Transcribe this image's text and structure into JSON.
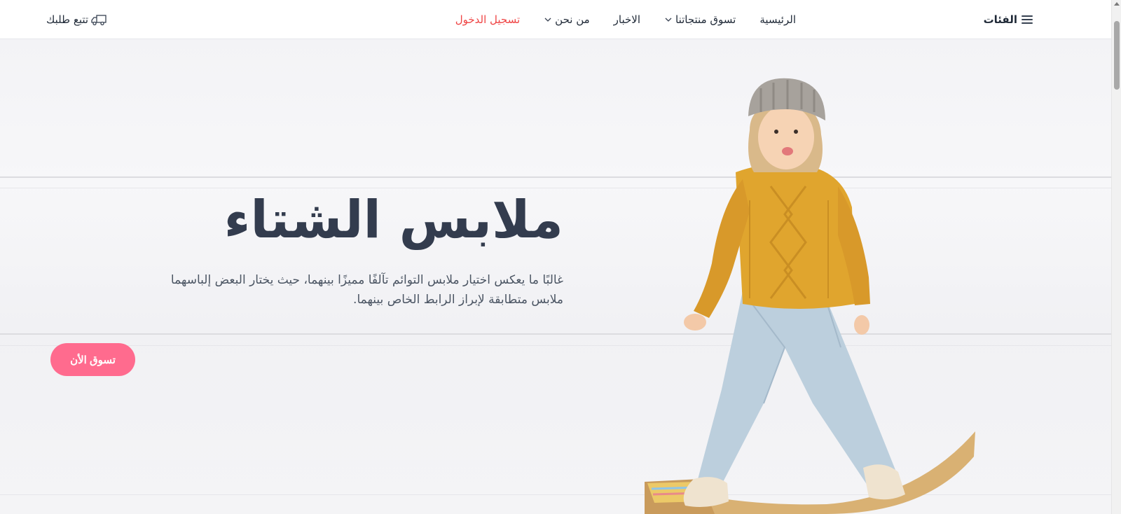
{
  "header": {
    "categories_label": "الفئات",
    "track_order_label": "تتبع طلبك",
    "nav": {
      "home": "الرئيسية",
      "shop": "تسوق منتجاتنا",
      "news": "الاخبار",
      "about": "من نحن",
      "login": "تسجيل الدخول"
    }
  },
  "hero": {
    "title": "ملابس الشتاء",
    "description": "غالبًا ما يعكس اختيار ملابس التوائم تآلفًا مميزًا بينهما، حيث يختار البعض إلباسهما ملابس متطابقة لإبراز الرابط الخاص بينهما.",
    "cta_label": "تسوق الأن"
  },
  "icons": {
    "categories": "menu-icon",
    "track": "truck-icon",
    "dropdown": "chevron-down-icon"
  },
  "colors": {
    "login": "#ef4444",
    "cta_bg": "#ff6b8e",
    "title": "#333c4e",
    "sweater": "#e0a52e"
  }
}
